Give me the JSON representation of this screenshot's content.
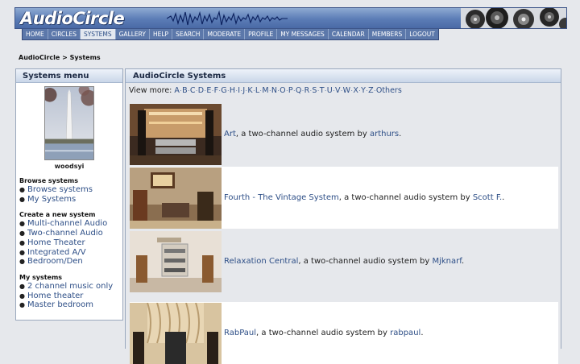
{
  "site": {
    "logo": "AudioCircle",
    "colors": {
      "banner": "#5b7cb6",
      "link": "#2e4f87",
      "panel_header": "#c9d6e8"
    }
  },
  "nav": [
    {
      "label": "HOME"
    },
    {
      "label": "CIRCLES"
    },
    {
      "label": "SYSTEMS",
      "active": true
    },
    {
      "label": "GALLERY"
    },
    {
      "label": "HELP"
    },
    {
      "label": "SEARCH"
    },
    {
      "label": "MODERATE"
    },
    {
      "label": "PROFILE"
    },
    {
      "label": "MY MESSAGES"
    },
    {
      "label": "CALENDAR"
    },
    {
      "label": "MEMBERS"
    },
    {
      "label": "LOGOUT"
    }
  ],
  "breadcrumb": {
    "root": "AudioCircle",
    "sep": " > ",
    "current": "Systems"
  },
  "sidebar": {
    "title": "Systems menu",
    "user": {
      "name": "woodsyi",
      "photo_icon": "monument-photo"
    },
    "sections": [
      {
        "title": "Browse systems",
        "links": [
          "Browse systems",
          "My Systems"
        ]
      },
      {
        "title": "Create a new system",
        "links": [
          "Multi-channel Audio",
          "Two-channel Audio",
          "Home Theater",
          "Integrated A/V",
          "Bedroom/Den"
        ]
      },
      {
        "title": "My systems",
        "links": [
          "2 channel music only",
          "Home theater",
          "Master bedroom"
        ]
      }
    ]
  },
  "main": {
    "title": "AudioCircle Systems",
    "view_more_label": "View more:",
    "letters": [
      "A",
      "B",
      "C",
      "D",
      "E",
      "F",
      "G",
      "H",
      "I",
      "J",
      "K",
      "L",
      "M",
      "N",
      "O",
      "P",
      "Q",
      "R",
      "S",
      "T",
      "U",
      "V",
      "W",
      "X",
      "Y",
      "Z",
      "Others"
    ],
    "systems": [
      {
        "name": "Art",
        "desc": ", a two-channel audio system by ",
        "user": "arthurs",
        "end": ".",
        "thumb": "wood-wall-room"
      },
      {
        "name": "Fourth - The Vintage System",
        "desc": ", a two-channel audio system by ",
        "user": "Scott F.",
        "end": ".",
        "thumb": "vintage-room"
      },
      {
        "name": "Relaxation Central",
        "desc": ", a two-channel audio system by ",
        "user": "Mjknarf",
        "end": ".",
        "thumb": "white-rack-room"
      },
      {
        "name": "RabPaul",
        "desc": ", a two-channel audio system by ",
        "user": "rabpaul",
        "end": ".",
        "thumb": "curtain-room"
      }
    ]
  }
}
